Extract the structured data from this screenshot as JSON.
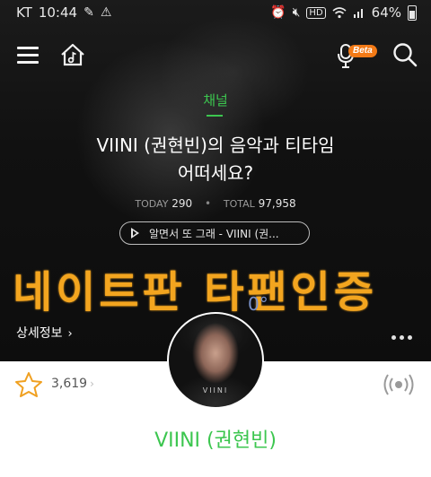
{
  "status_bar": {
    "carrier": "KT",
    "time": "10:44",
    "battery": "64%"
  },
  "nav": {
    "menu_icon": "hamburger-menu-icon",
    "home_icon": "home-music-icon",
    "voice_icon": "voice-search-icon",
    "voice_badge": "Beta",
    "search_icon": "search-icon"
  },
  "channel": {
    "label": "채널",
    "title_line1": "VIINI (권현빈)의 음악과 티타임",
    "title_line2": "어떠세요?",
    "today_label": "TODAY",
    "today_value": "290",
    "total_label": "TOTAL",
    "total_value": "97,958",
    "now_playing": "알면서 또 그래 - VIINI (권..."
  },
  "overlay": {
    "text": "네이트판 타팬인증",
    "degree": "0°"
  },
  "details": {
    "label": "상세정보",
    "chevron": "›"
  },
  "more_icon": "more-dots-icon",
  "likes": {
    "icon": "star-icon",
    "count": "3,619",
    "chevron": "›"
  },
  "radio_icon": "radio-broadcast-icon",
  "artist": {
    "name": "VIINI (권현빈)",
    "avatar_tag": "VIINI"
  },
  "colors": {
    "accent_green": "#3cc64f",
    "overlay_orange": "#f3a51f",
    "beta_orange": "#f37a16"
  }
}
